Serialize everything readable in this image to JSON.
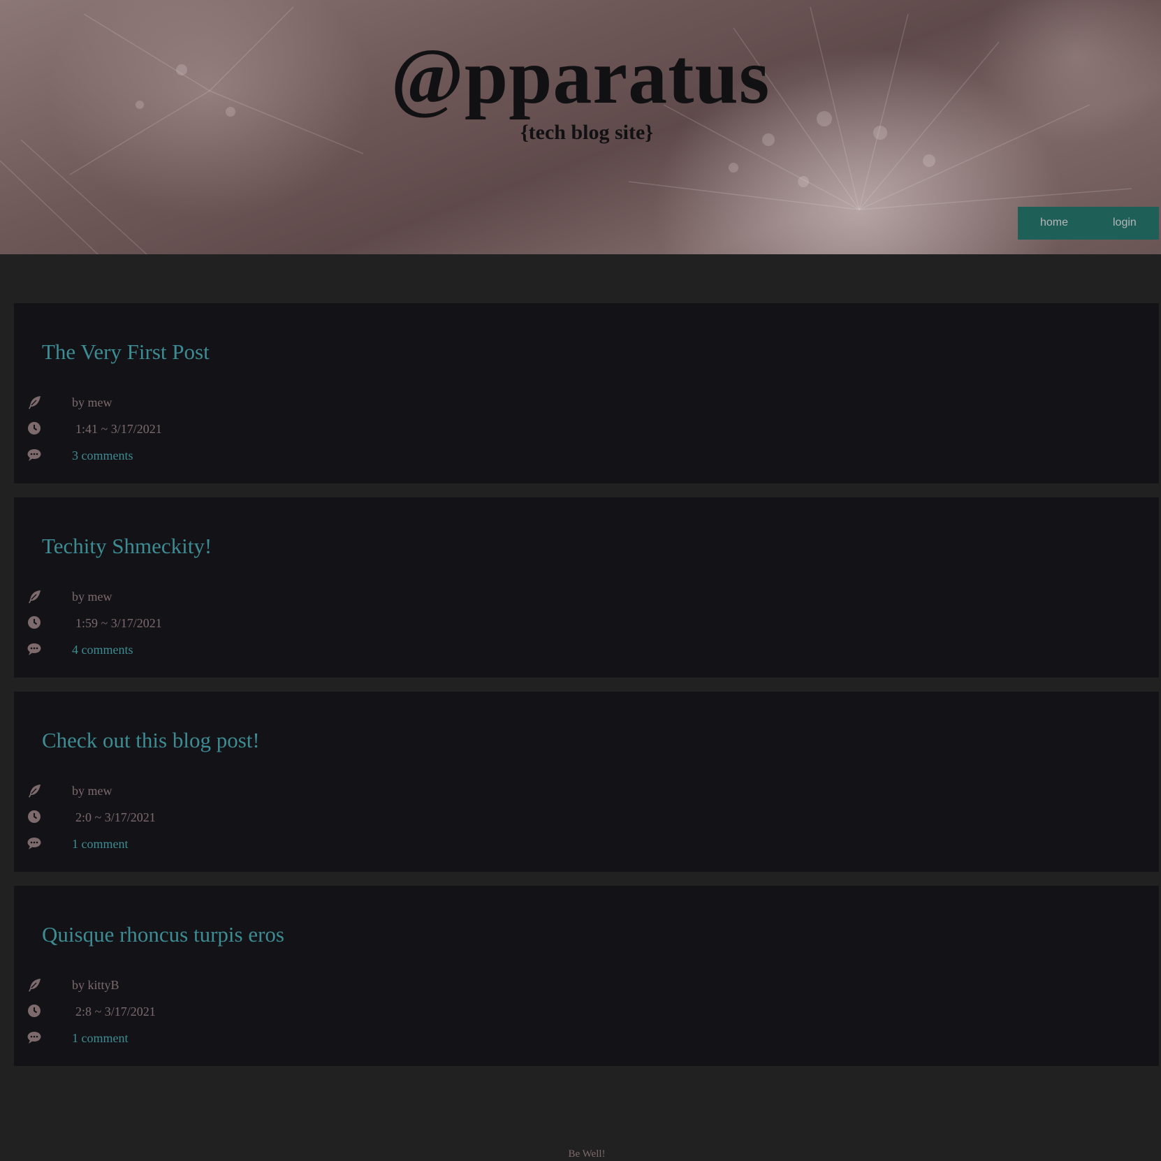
{
  "header": {
    "title": "@pparatus",
    "subtitle": "{tech blog site}"
  },
  "nav": {
    "items": [
      {
        "label": "home"
      },
      {
        "label": "login"
      }
    ]
  },
  "posts": [
    {
      "title": "The Very First Post",
      "author": "by mew",
      "time": "1:41 ~ 3/17/2021",
      "comments": "3 comments"
    },
    {
      "title": "Techity Shmeckity!",
      "author": "by mew",
      "time": "1:59 ~ 3/17/2021",
      "comments": "4 comments"
    },
    {
      "title": "Check out this blog post!",
      "author": "by mew",
      "time": "2:0 ~ 3/17/2021",
      "comments": "1 comment"
    },
    {
      "title": "Quisque rhoncus turpis eros",
      "author": "by kittyB",
      "time": "2:8 ~ 3/17/2021",
      "comments": "1 comment"
    }
  ],
  "footer": {
    "text": "Be Well!"
  },
  "colors": {
    "page_background": "#212121",
    "card_background": "#131317",
    "accent_teal": "#3e8c93",
    "muted_text": "#7d6a6c",
    "nav_background": "#1e5f58"
  },
  "icons": {
    "author": "feather-icon",
    "time": "clock-icon",
    "comments": "comment-icon"
  }
}
